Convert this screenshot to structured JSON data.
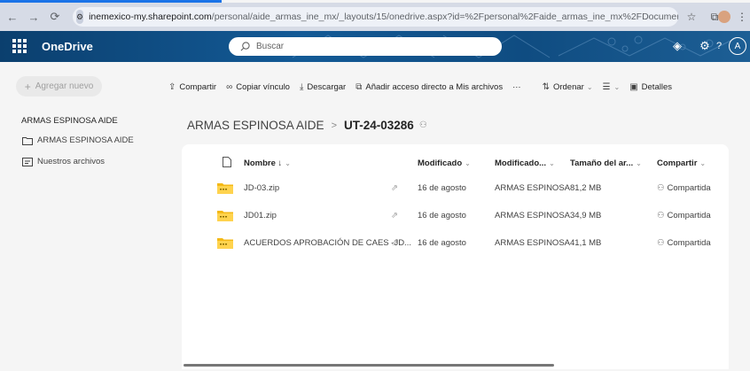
{
  "browser": {
    "url_host": "inemexico-my.sharepoint.com",
    "url_path": "/personal/aide_armas_ine_mx/_layouts/15/onedrive.aspx?id=%2Fpersonal%2Faide_armas_ine_mx%2FDocuments%2FUT-...",
    "avatar_initial": "A"
  },
  "app": {
    "title": "OneDrive",
    "search_placeholder": "Buscar",
    "user_initial": "A"
  },
  "sidebar": {
    "new_label": "Agregar nuevo",
    "owner": "ARMAS ESPINOSA AIDE",
    "items": [
      {
        "label": "ARMAS ESPINOSA AIDE",
        "icon": "folder-icon"
      },
      {
        "label": "Nuestros archivos",
        "icon": "shared-files-icon"
      }
    ]
  },
  "commands": {
    "share": "Compartir",
    "copy_link": "Copiar vínculo",
    "download": "Descargar",
    "add_shortcut": "Añadir acceso directo a Mis archivos",
    "more": "···",
    "sort": "Ordenar",
    "view_chevron": "⌄",
    "details": "Detalles"
  },
  "breadcrumb": {
    "root": "ARMAS ESPINOSA AIDE",
    "separator": ">",
    "current": "UT-24-03286"
  },
  "table": {
    "headers": {
      "name": "Nombre ↓",
      "modified": "Modificado",
      "modified_by": "Modificado...",
      "size": "Tamaño del ar...",
      "sharing": "Compartir"
    },
    "rows": [
      {
        "name": "JD-03.zip",
        "modified": "16 de agosto",
        "modified_by": "ARMAS ESPINOSA",
        "size": "81,2 MB",
        "sharing": "Compartida"
      },
      {
        "name": "JD01.zip",
        "modified": "16 de agosto",
        "modified_by": "ARMAS ESPINOSA",
        "size": "34,9 MB",
        "sharing": "Compartida"
      },
      {
        "name": "ACUERDOS APROBACIÓN DE CAES -JD...",
        "modified": "16 de agosto",
        "modified_by": "ARMAS ESPINOSA",
        "size": "41,1 MB",
        "sharing": "Compartida"
      }
    ]
  },
  "colors": {
    "app_bar": "#0f4c81",
    "folder": "#f4b916",
    "browser_chrome": "#d6dbe6"
  }
}
